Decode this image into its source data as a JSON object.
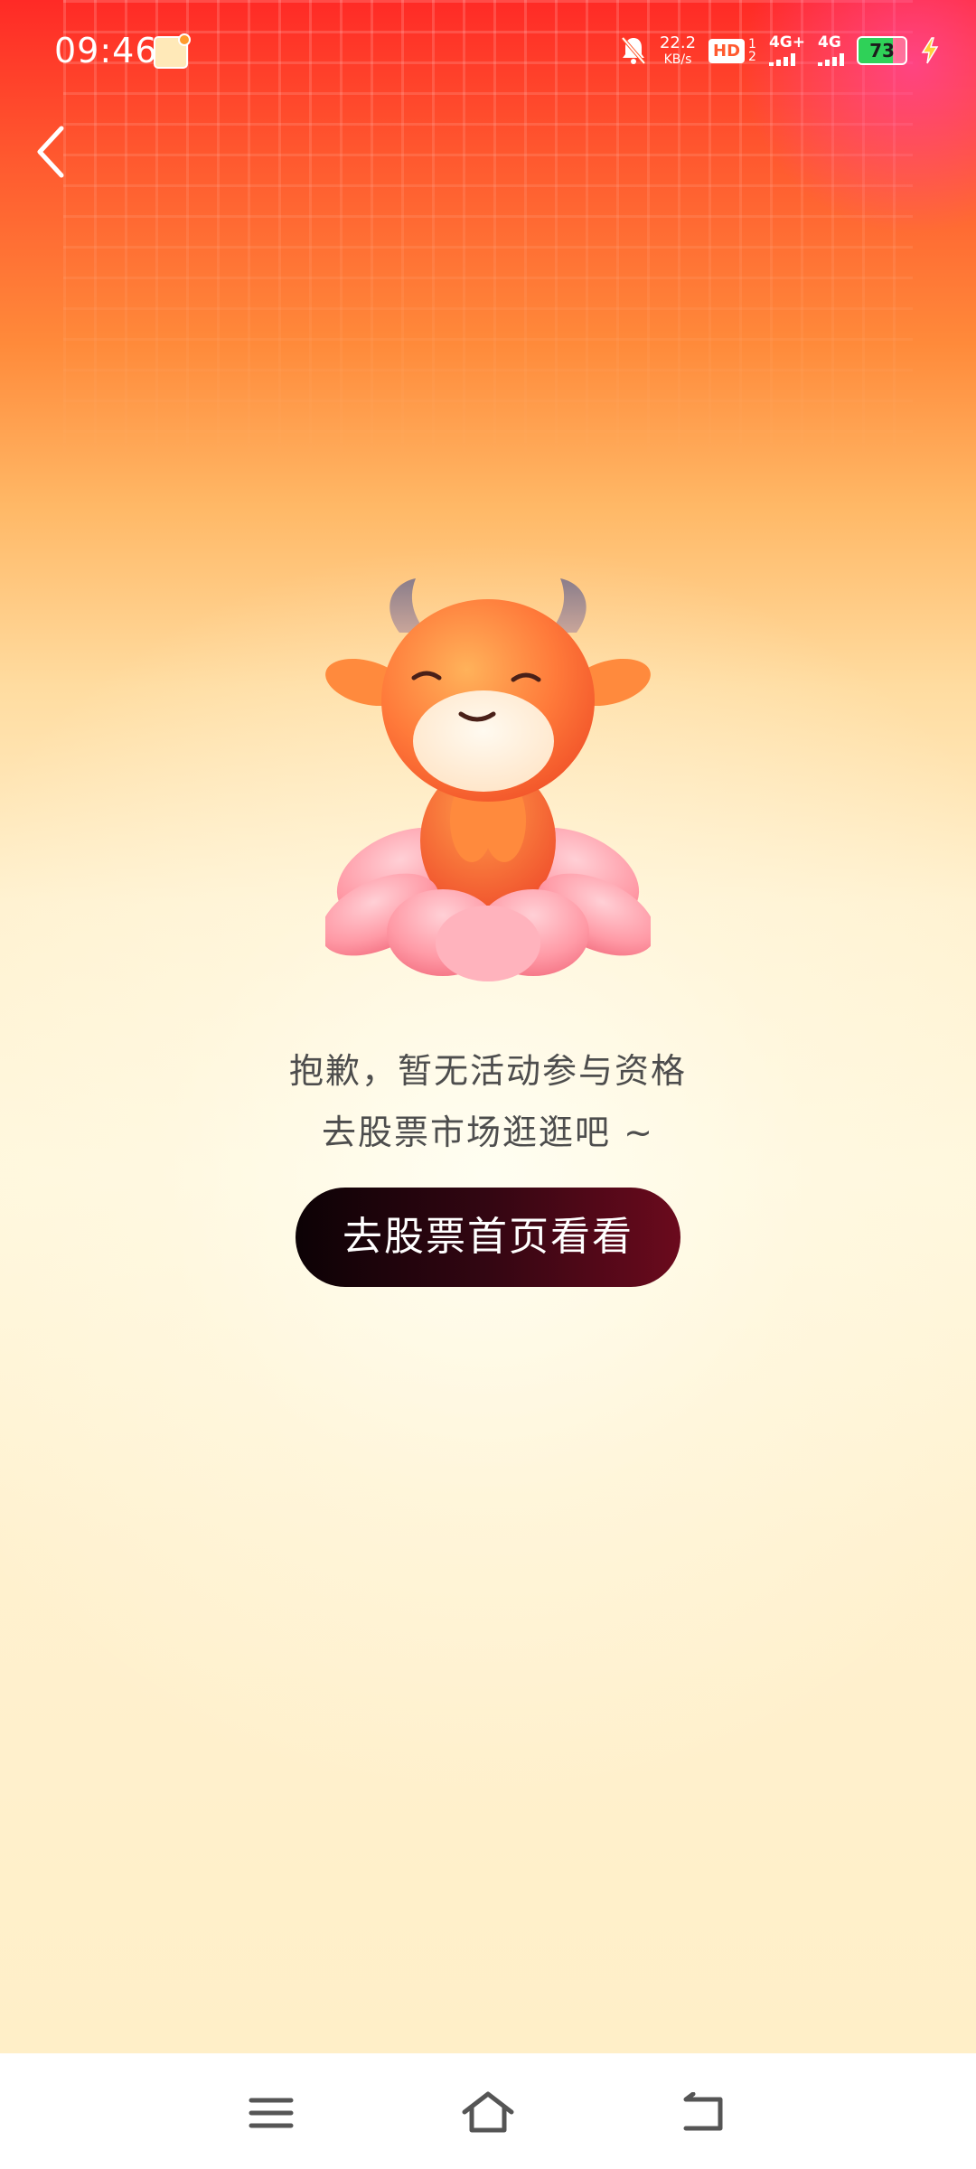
{
  "status_bar": {
    "time": "09:46",
    "net_speed_value": "22.2",
    "net_speed_unit": "KB/s",
    "hd_label": "HD",
    "hd_sim_top": "1",
    "hd_sim_bottom": "2",
    "signal_1_label": "4G+",
    "signal_2_label": "4G",
    "battery_level": "73",
    "battery_fill_percent": 73,
    "icons": [
      "app-notification-icon",
      "mute-bell-icon",
      "battery-icon",
      "charging-bolt-icon"
    ]
  },
  "header": {
    "back_icon": "chevron-left-icon"
  },
  "main": {
    "illustration": "mascot-calf-on-lotus",
    "message_line_1": "抱歉，暂无活动参与资格",
    "message_line_2": "去股票市场逛逛吧 ~",
    "cta_label": "去股票首页看看"
  },
  "nav_bar": {
    "icons": [
      "menu-icon",
      "home-icon",
      "back-icon"
    ]
  },
  "colors": {
    "header_red": "#ff2a26",
    "cta_dark": "#0c0205",
    "cta_wine": "#6b0a1d",
    "text_grey": "#4d4d4d",
    "battery_green": "#2fd158"
  }
}
